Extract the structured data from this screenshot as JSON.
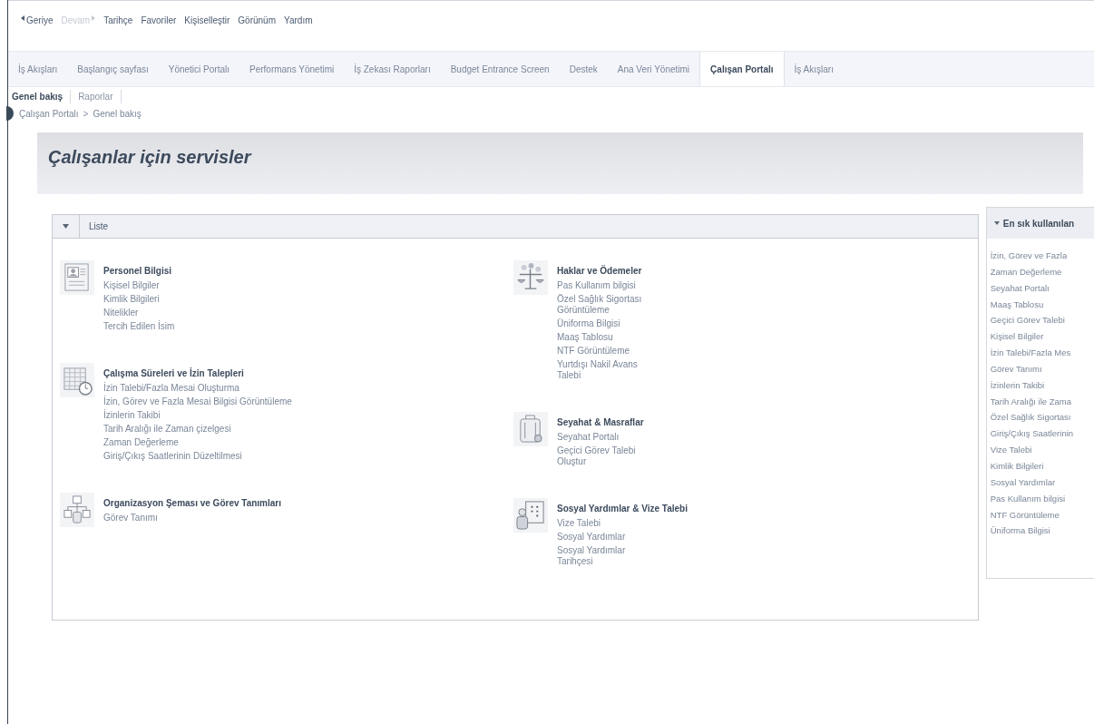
{
  "menu": [
    {
      "label": "Geriye",
      "disabled": false,
      "kind": "back"
    },
    {
      "label": "Devam",
      "disabled": true,
      "kind": "forward"
    },
    {
      "label": "Tarihçe",
      "disabled": false
    },
    {
      "label": "Favoriler",
      "disabled": false
    },
    {
      "label": "Kişiselleştir",
      "disabled": false
    },
    {
      "label": "Görünüm",
      "disabled": false
    },
    {
      "label": "Yardım",
      "disabled": false
    }
  ],
  "tabs": [
    {
      "label": "İş Akışları",
      "selected": false
    },
    {
      "label": "Başlangıç sayfası",
      "selected": false
    },
    {
      "label": "Yönetici Portalı",
      "selected": false
    },
    {
      "label": "Performans Yönetimi",
      "selected": false
    },
    {
      "label": "İş Zekası Raporları",
      "selected": false
    },
    {
      "label": "Budget Entrance Screen",
      "selected": false
    },
    {
      "label": "Destek",
      "selected": false
    },
    {
      "label": "Ana Veri Yönetimi",
      "selected": false
    },
    {
      "label": "Çalışan Portalı",
      "selected": true
    },
    {
      "label": "İş Akışları",
      "selected": false
    }
  ],
  "subtabs": [
    {
      "label": "Genel bakış",
      "selected": true
    },
    {
      "label": "Raporlar",
      "selected": false
    }
  ],
  "breadcrumb": {
    "items": [
      "Çalışan Portalı",
      "Genel bakış"
    ],
    "separator": ">"
  },
  "page_title": "Çalışanlar için servisler",
  "panel": {
    "title": "Liste",
    "columns": [
      [
        {
          "kind": "person-card",
          "title": "Personel Bilgisi",
          "links": [
            "Kişisel Bilgiler",
            "Kimlik Bilgileri",
            "Nitelikler",
            "Tercih Edilen İsim"
          ]
        },
        {
          "kind": "calendar-clock",
          "title": "Çalışma Süreleri ve İzin Talepleri",
          "links": [
            "İzin Talebi/Fazla Mesai Oluşturma",
            "İzin, Görev ve Fazla Mesai Bilgisi Görüntüleme",
            "İzinlerin Takibi",
            "Tarih Aralığı ile Zaman çizelgesi",
            "Zaman Değerleme",
            "Giriş/Çıkış Saatlerinin Düzeltilmesi"
          ]
        },
        {
          "kind": "org-chart",
          "title": "Organizasyon Şeması ve Görev Tanımları",
          "links": [
            "Görev Tanımı"
          ]
        }
      ],
      [
        {
          "kind": "scales",
          "title": "Haklar ve Ödemeler",
          "links": [
            "Pas Kullanım bilgisi",
            "Özel Sağlık Sigortası Görüntüleme",
            "Üniforma Bilgisi",
            "Maaş Tablosu",
            "NTF Görüntüleme",
            "Yurtdışı Nakil Avans Talebi"
          ]
        },
        {
          "kind": "luggage",
          "title": "Seyahat & Masraflar",
          "links": [
            "Seyahat Portalı",
            "Geçici Görev Talebi Oluştur"
          ]
        },
        {
          "kind": "person-board",
          "title": "Sosyal Yardımlar & Vize Talebi",
          "links": [
            "Vize Talebi",
            "Sosyal Yardımlar",
            "Sosyal Yardımlar Tarihçesi"
          ]
        }
      ]
    ]
  },
  "sidebar": {
    "title": "En sık kullanılan",
    "links": [
      "İzin, Görev ve Fazla",
      "Zaman Değerleme",
      "Seyahat Portalı",
      "Maaş Tablosu",
      "Geçici Görev Talebi",
      "Kişisel Bilgiler",
      "İzin Talebi/Fazla Mes",
      "Görev Tanımı",
      "İzinlerin Takibi",
      "Tarih Aralığı ile Zama",
      "Özel Sağlık Sigortası",
      "Giriş/Çıkış Saatlerinin",
      "Vize Talebi",
      "Kimlik Bilgileri",
      "Sosyal Yardımlar",
      "Pas Kullanım bilgisi",
      "NTF Görüntüleme",
      "Üniforma Bilgisi"
    ]
  }
}
